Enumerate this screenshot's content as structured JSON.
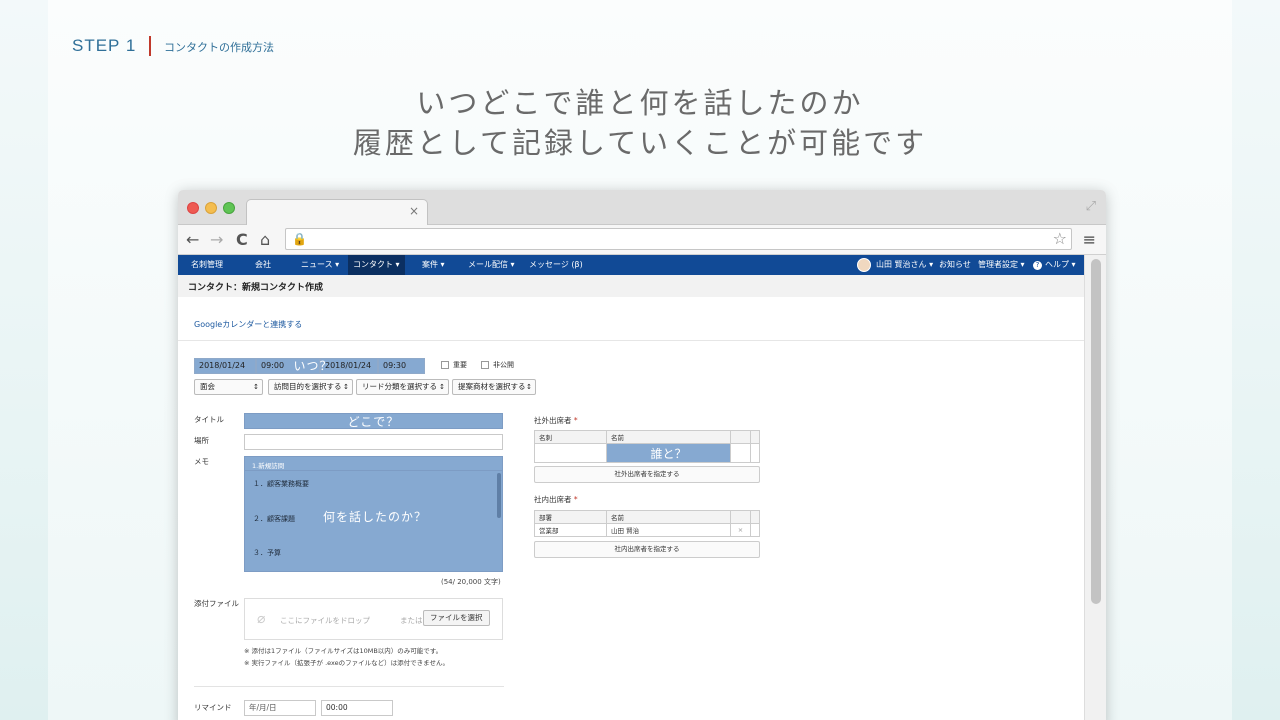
{
  "slide": {
    "step": "STEP 1",
    "step_subtitle": "コンタクトの作成方法",
    "headline_1": "いつどこで誰と何を話したのか",
    "headline_2": "履歴として記録していくことが可能です"
  },
  "browser": {
    "tab_close": "×",
    "back_icon": "←",
    "forward_icon": "→",
    "reload_icon": "C",
    "home_icon": "⌂",
    "star_icon": "☆",
    "menu_icon": "≡"
  },
  "appnav": {
    "items": [
      "名刺管理",
      "会社",
      "ニュース ▾",
      "コンタクト ▾",
      "案件 ▾",
      "メール配信 ▾",
      "メッセージ (β)"
    ],
    "user": "山田 賢治さん ▾",
    "notice": "お知らせ",
    "admin": "管理者設定 ▾",
    "help": "ヘルプ ▾"
  },
  "page": {
    "title": "コンタクト：新規コンタクト作成",
    "gcal_link": "Googleカレンダーと連携する"
  },
  "form": {
    "start_date": "2018/01/24",
    "start_time": "09:00",
    "end_date": "2018/01/24",
    "end_time": "09:30",
    "when_overlay": "いつ？",
    "important": "重要",
    "private": "非公開",
    "selects": [
      "面会",
      "訪問目的を選択する",
      "リード分類を選択する",
      "提案商材を選択する"
    ],
    "title_label": "タイトル",
    "where_overlay": "どこで？",
    "place_label": "場所",
    "memo_label": "メモ",
    "memo_template": "1.新規訪問",
    "memo_lines": [
      "１．顧客業務概要",
      "２．顧客課題",
      "３．予算"
    ],
    "memo_overlay": "何を話したのか？",
    "counter": "(54/ 20,000 文字)",
    "attach_label": "添付ファイル",
    "drop_text": "ここにファイルをドロップ",
    "or_text": "または",
    "file_button": "ファイルを選択",
    "note_1": "※ 添付は1ファイル（ファイルサイズは10MB以内）のみ可能です。",
    "note_2": "※ 実行ファイル（拡張子が .exeのファイルなど）は添付できません。",
    "remind_label": "リマインド",
    "remind_date_placeholder": "年/月/日",
    "remind_time": "00:00"
  },
  "attendees": {
    "external_label": "社外出席者",
    "external_cols": [
      "名刺",
      "名前"
    ],
    "who_overlay": "誰と？",
    "external_button": "社外出席者を指定する",
    "internal_label": "社内出席者",
    "internal_cols": [
      "部署",
      "名前"
    ],
    "internal_row": [
      "営業部",
      "山田 賢治"
    ],
    "remove_icon": "×",
    "internal_button": "社内出席者を指定する",
    "required_mark": "*"
  },
  "colors": {
    "nav": "#114a96",
    "highlight": "#86a9d1",
    "step": "#2f6f98",
    "accent": "#c0392b"
  }
}
